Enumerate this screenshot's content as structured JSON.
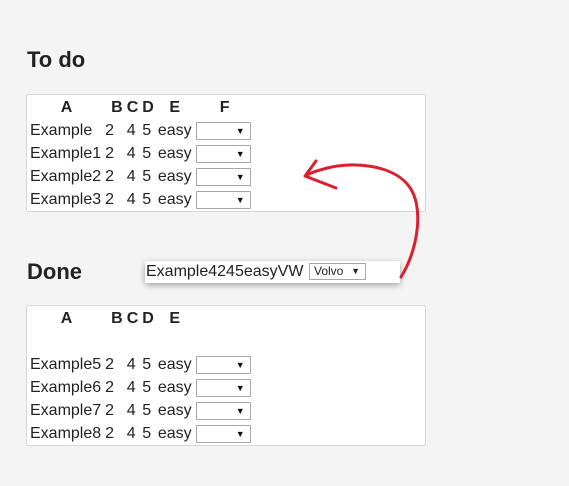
{
  "todo": {
    "title": "To do",
    "headers": [
      "A",
      "B",
      "C",
      "D",
      "E",
      "F"
    ],
    "rows": [
      {
        "a": "Example",
        "b": "2",
        "c": "4",
        "d": "5",
        "e": "easy",
        "f": ""
      },
      {
        "a": "Example1",
        "b": "2",
        "c": "4",
        "d": "5",
        "e": "easy",
        "f": ""
      },
      {
        "a": "Example2",
        "b": "2",
        "c": "4",
        "d": "5",
        "e": "easy",
        "f": ""
      },
      {
        "a": "Example3",
        "b": "2",
        "c": "4",
        "d": "5",
        "e": "easy",
        "f": ""
      }
    ]
  },
  "done": {
    "title": "Done",
    "headers": [
      "A",
      "B",
      "C",
      "D",
      "E"
    ],
    "rows": [
      {
        "a": "Example5",
        "b": "2",
        "c": "4",
        "d": "5",
        "e": "easy",
        "f": ""
      },
      {
        "a": "Example6",
        "b": "2",
        "c": "4",
        "d": "5",
        "e": "easy",
        "f": ""
      },
      {
        "a": "Example7",
        "b": "2",
        "c": "4",
        "d": "5",
        "e": "easy",
        "f": ""
      },
      {
        "a": "Example8",
        "b": "2",
        "c": "4",
        "d": "5",
        "e": "easy",
        "f": ""
      }
    ]
  },
  "dragging_row": {
    "text": "Example4245easyVW",
    "select_value": "Volvo"
  },
  "icons": {
    "select_arrow": "dropdown-triangle",
    "annotation": "red-curved-arrow"
  },
  "colors": {
    "background": "#f4f4f4",
    "annotation_arrow": "#d9202e"
  }
}
